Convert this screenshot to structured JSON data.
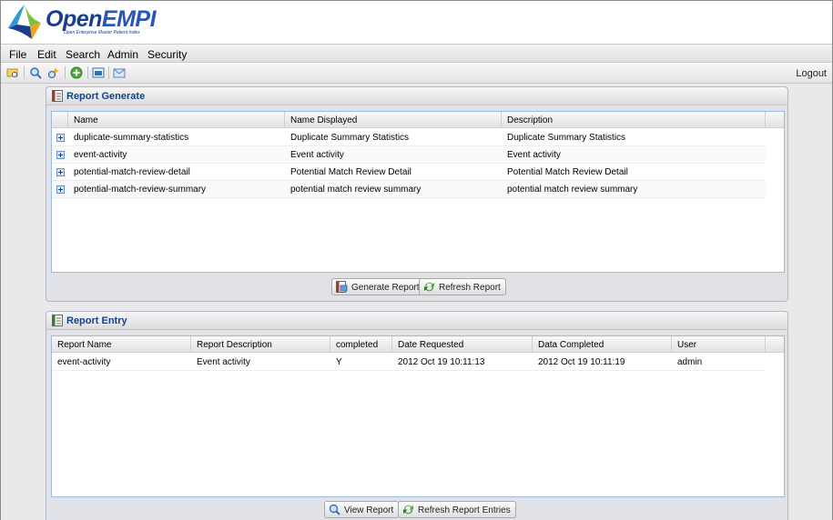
{
  "app": {
    "logo_text_a": "Open",
    "logo_text_b": "EMPI",
    "logo_tagline": "Open Enterprise Master Patient Index"
  },
  "menu": {
    "items": [
      "File",
      "Edit",
      "Search",
      "Admin",
      "Security"
    ]
  },
  "toolbar": {
    "icons": [
      "folder-search-icon",
      "zoom-icon",
      "magic-search-icon",
      "add-icon",
      "image-icon",
      "mail-icon"
    ],
    "logout_label": "Logout"
  },
  "report_generate": {
    "title": "Report Generate",
    "columns": [
      "Name",
      "Name Displayed",
      "Description"
    ],
    "rows": [
      {
        "name": "duplicate-summary-statistics",
        "display": "Duplicate Summary Statistics",
        "description": "Duplicate Summary Statistics"
      },
      {
        "name": "event-activity",
        "display": "Event activity",
        "description": "Event activity"
      },
      {
        "name": "potential-match-review-detail",
        "display": "Potential Match Review Detail",
        "description": "Potential Match Review Detail"
      },
      {
        "name": "potential-match-review-summary",
        "display": "potential match review summary",
        "description": "potential match review summary"
      }
    ],
    "generate_button": "Generate Report",
    "refresh_button": "Refresh Report"
  },
  "report_entry": {
    "title": "Report Entry",
    "columns": [
      "Report Name",
      "Report Description",
      "completed",
      "Date Requested",
      "Data Completed",
      "User"
    ],
    "rows": [
      {
        "name": "event-activity",
        "description": "Event activity",
        "completed": "Y",
        "requested": "2012 Oct 19 10:11:13",
        "completed_at": "2012 Oct 19 10:11:19",
        "user": "admin"
      }
    ],
    "view_button": "View Report",
    "refresh_button": "Refresh Report Entries"
  },
  "colors": {
    "accent": "#15428b",
    "grid_border": "#99bbe8"
  }
}
